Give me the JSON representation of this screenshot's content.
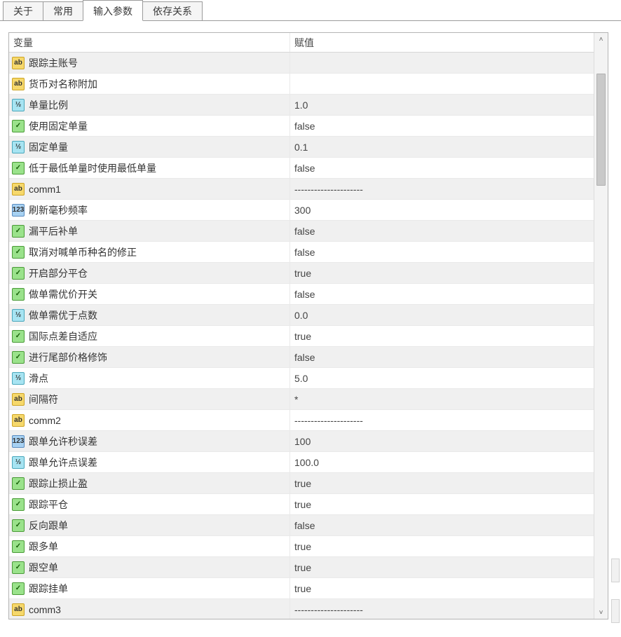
{
  "tabs": {
    "about": "关于",
    "common": "常用",
    "inputs": "输入参数",
    "deps": "依存关系"
  },
  "grid": {
    "header_var": "变量",
    "header_value": "赋值"
  },
  "rows": [
    {
      "icon": "ab",
      "name": "跟踪主账号",
      "value": ""
    },
    {
      "icon": "ab",
      "name": "货币对名称附加",
      "value": ""
    },
    {
      "icon": "v2",
      "name": "单量比例",
      "value": "1.0"
    },
    {
      "icon": "bool",
      "name": "使用固定单量",
      "value": "false"
    },
    {
      "icon": "v2",
      "name": "固定单量",
      "value": "0.1"
    },
    {
      "icon": "bool",
      "name": "低于最低单量时使用最低单量",
      "value": "false"
    },
    {
      "icon": "ab",
      "name": "comm1",
      "value": "---------------------"
    },
    {
      "icon": "123",
      "name": "刷新毫秒频率",
      "value": "300"
    },
    {
      "icon": "bool",
      "name": "漏平后补单",
      "value": "false"
    },
    {
      "icon": "bool",
      "name": "取消对喊单币种名的修正",
      "value": "false"
    },
    {
      "icon": "bool",
      "name": "开启部分平仓",
      "value": "true"
    },
    {
      "icon": "bool",
      "name": "做单需优价开关",
      "value": "false"
    },
    {
      "icon": "v2",
      "name": "做单需优于点数",
      "value": "0.0"
    },
    {
      "icon": "bool",
      "name": "国际点差自适应",
      "value": "true"
    },
    {
      "icon": "bool",
      "name": "进行尾部价格修饰",
      "value": "false"
    },
    {
      "icon": "v2",
      "name": "滑点",
      "value": "5.0"
    },
    {
      "icon": "ab",
      "name": "间隔符",
      "value": "*"
    },
    {
      "icon": "ab",
      "name": "comm2",
      "value": "---------------------"
    },
    {
      "icon": "123",
      "name": "跟单允许秒误差",
      "value": "100"
    },
    {
      "icon": "v2",
      "name": "跟单允许点误差",
      "value": "100.0"
    },
    {
      "icon": "bool",
      "name": "跟踪止损止盈",
      "value": "true"
    },
    {
      "icon": "bool",
      "name": "跟踪平仓",
      "value": "true"
    },
    {
      "icon": "bool",
      "name": "反向跟单",
      "value": "false"
    },
    {
      "icon": "bool",
      "name": "跟多单",
      "value": "true"
    },
    {
      "icon": "bool",
      "name": "跟空单",
      "value": "true"
    },
    {
      "icon": "bool",
      "name": "跟踪挂单",
      "value": "true"
    },
    {
      "icon": "ab",
      "name": "comm3",
      "value": "---------------------"
    }
  ],
  "icon_glyph": {
    "ab": "ab",
    "v2": "½",
    "bool": "✓",
    "123": "123"
  }
}
